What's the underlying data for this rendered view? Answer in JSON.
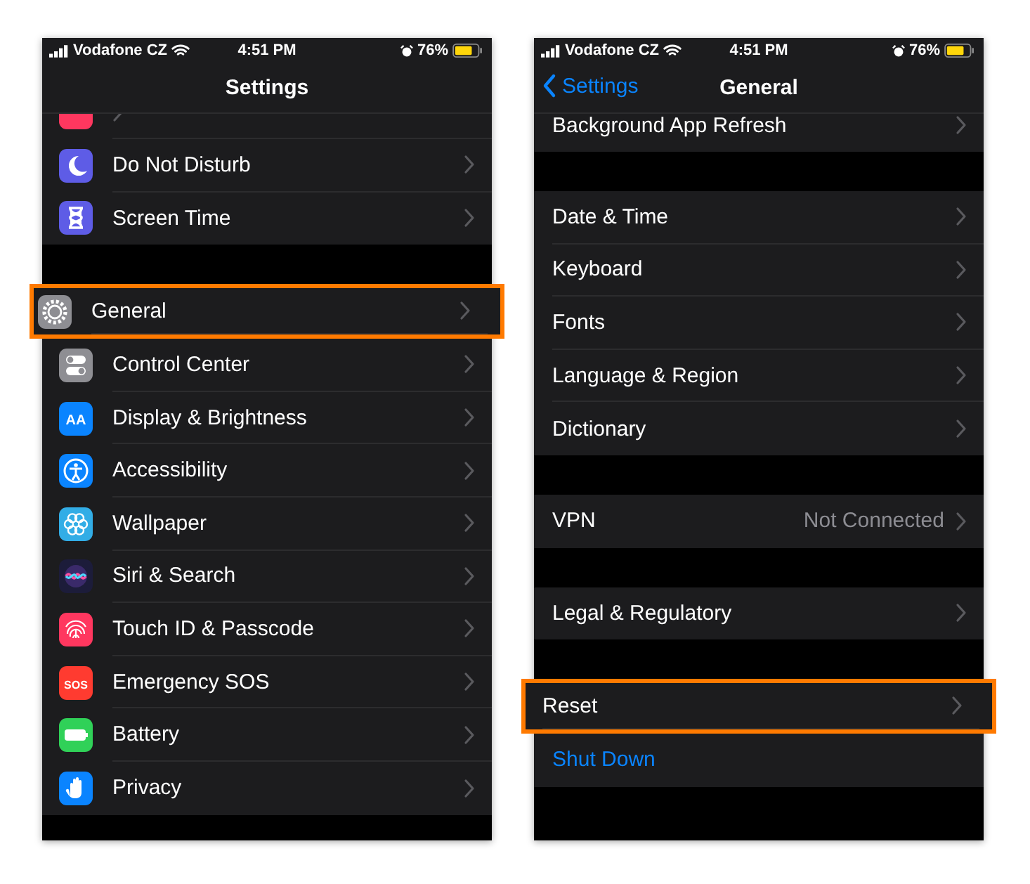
{
  "screens": [
    {
      "status_bar": {
        "carrier": "Vodafone CZ",
        "time": "4:51 PM",
        "battery": "76%"
      },
      "nav": {
        "title": "Settings"
      },
      "groups": [
        {
          "rows": [
            {
              "kind": "nav",
              "cut": true,
              "color": "#ff375f",
              "highlighted": false
            },
            {
              "kind": "nav",
              "label": "Do Not Disturb",
              "color": "#5e5ce6",
              "highlighted": false
            },
            {
              "kind": "nav",
              "label": "Screen Time",
              "color": "#5e5ce6",
              "highlighted": false
            }
          ]
        },
        {
          "rows": [
            {
              "kind": "nav",
              "label": "General",
              "color": "#8e8e93",
              "highlighted": true
            },
            {
              "kind": "nav",
              "label": "Control Center",
              "color": "#8e8e93",
              "highlighted": false
            },
            {
              "kind": "nav",
              "label": "Display & Brightness",
              "glyph": "AA",
              "color": "#0a84ff",
              "highlighted": false
            },
            {
              "kind": "nav",
              "label": "Accessibility",
              "color": "#0a84ff",
              "highlighted": false
            },
            {
              "kind": "nav",
              "label": "Wallpaper",
              "color": "#32ade6",
              "highlighted": false
            },
            {
              "kind": "nav",
              "label": "Siri & Search",
              "color": "#1c1c3a",
              "highlighted": false
            },
            {
              "kind": "nav",
              "label": "Touch ID & Passcode",
              "color": "#ff375f",
              "highlighted": false
            },
            {
              "kind": "nav",
              "label": "Emergency SOS",
              "glyph": "SOS",
              "color": "#ff3b30",
              "highlighted": false
            },
            {
              "kind": "nav",
              "label": "Battery",
              "color": "#30d158",
              "highlighted": false
            },
            {
              "kind": "nav",
              "label": "Privacy",
              "color": "#0a84ff",
              "highlighted": false
            }
          ]
        }
      ]
    },
    {
      "status_bar": {
        "carrier": "Vodafone CZ",
        "time": "4:51 PM",
        "battery": "76%"
      },
      "nav": {
        "back": "Settings",
        "title": "General"
      },
      "groups": [
        {
          "rows": [
            {
              "kind": "nav",
              "cut": true,
              "label": "Background App Refresh",
              "highlighted": false
            }
          ]
        },
        {
          "rows": [
            {
              "kind": "nav",
              "label": "Date & Time",
              "highlighted": false
            },
            {
              "kind": "nav",
              "label": "Keyboard",
              "highlighted": false
            },
            {
              "kind": "nav",
              "label": "Fonts",
              "highlighted": false
            },
            {
              "kind": "nav",
              "label": "Language & Region",
              "highlighted": false
            },
            {
              "kind": "nav",
              "label": "Dictionary",
              "highlighted": false
            }
          ]
        },
        {
          "rows": [
            {
              "kind": "nav",
              "label": "VPN",
              "value": "Not Connected",
              "highlighted": false
            }
          ]
        },
        {
          "rows": [
            {
              "kind": "nav",
              "label": "Legal & Regulatory",
              "highlighted": false
            }
          ]
        },
        {
          "rows": [
            {
              "kind": "nav",
              "label": "Reset",
              "highlighted": true
            },
            {
              "kind": "action",
              "label": "Shut Down",
              "highlighted": false
            }
          ]
        }
      ]
    }
  ]
}
